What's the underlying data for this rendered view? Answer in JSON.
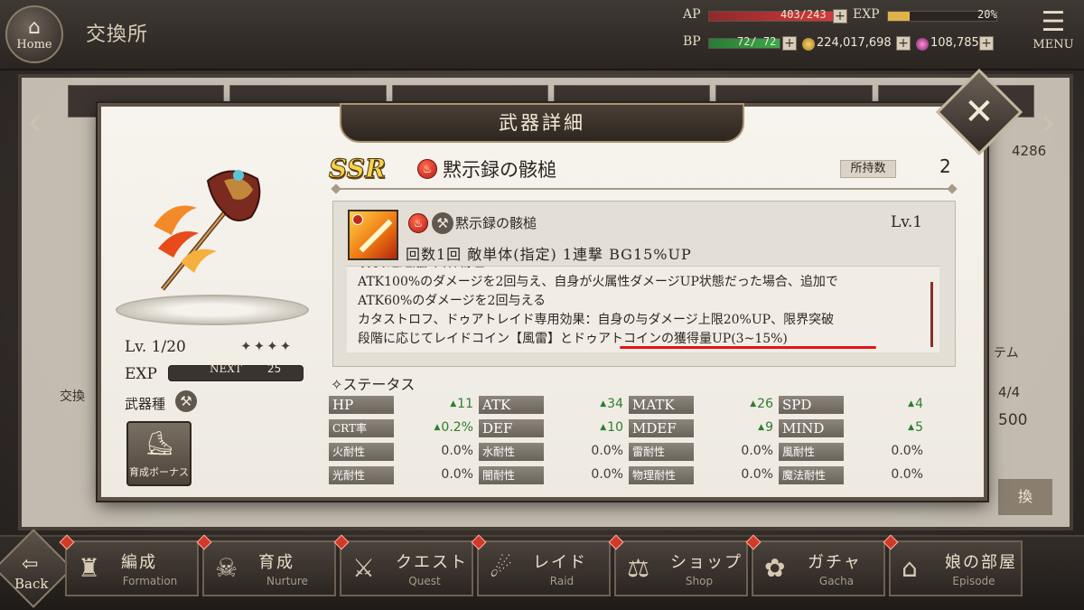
{
  "header": {
    "home_label": "Home",
    "title": "交換所",
    "ap_label": "AP",
    "ap_value": "403/243",
    "exp_label": "EXP",
    "exp_value": "20%",
    "bp_label": "BP",
    "bp_value": "72/ 72",
    "gold": "224,017,698",
    "gems": "108,785",
    "menu_label": "MENU",
    "colors": {
      "ap": "#d23a3a",
      "exp": "#e0b24a",
      "bp": "#3aa84a"
    }
  },
  "background": {
    "number": "4286",
    "text_a": "テム",
    "text_b": "4/4",
    "text_c": "500",
    "text_d": "交換",
    "button": "換"
  },
  "modal": {
    "title": "武器詳細",
    "rarity": "SSR",
    "weapon_name": "黙示録の骸槌",
    "owned_label": "所持数",
    "owned_count": "2",
    "level": "Lv.  1/20",
    "stars": "✦✦✦✦",
    "exp_label": "EXP",
    "exp_next_label": "NEXT",
    "exp_next_value": "25",
    "weapon_type_label": "武器種",
    "bonus_button": "育成ボーナス",
    "skill": {
      "name": "黙示録の骸槌",
      "level": "Lv.1",
      "summary": "回数1回  敵単体(指定)  1連撃  BG15%UP",
      "desc_lines": [
        "攻撃/近距離/単体/物理",
        "ATK100%のダメージを2回与え、自身が火属性ダメージUP状態だった場合、追加で",
        "ATK60%のダメージを2回与える",
        "カタストロフ、ドゥアトレイド専用効果：自身の与ダメージ上限20%UP、限界突破",
        "段階に応じてレイドコイン【風雷】とドゥアトコインの獲得量UP(3~15%)"
      ]
    },
    "status_header": "ステータス",
    "stats": [
      [
        {
          "label": "HP",
          "value": "11",
          "up": true
        },
        {
          "label": "ATK",
          "value": "34",
          "up": true
        },
        {
          "label": "MATK",
          "value": "26",
          "up": true
        },
        {
          "label": "SPD",
          "value": "4",
          "up": true
        }
      ],
      [
        {
          "label": "CRT率",
          "value": "0.2%",
          "up": true
        },
        {
          "label": "DEF",
          "value": "10",
          "up": true
        },
        {
          "label": "MDEF",
          "value": "9",
          "up": true
        },
        {
          "label": "MIND",
          "value": "5",
          "up": true
        }
      ],
      [
        {
          "label": "火耐性",
          "value": "0.0%",
          "up": false
        },
        {
          "label": "水耐性",
          "value": "0.0%",
          "up": false
        },
        {
          "label": "雷耐性",
          "value": "0.0%",
          "up": false
        },
        {
          "label": "風耐性",
          "value": "0.0%",
          "up": false
        }
      ],
      [
        {
          "label": "光耐性",
          "value": "0.0%",
          "up": false
        },
        {
          "label": "闇耐性",
          "value": "0.0%",
          "up": false
        },
        {
          "label": "物理耐性",
          "value": "0.0%",
          "up": false
        },
        {
          "label": "魔法耐性",
          "value": "0.0%",
          "up": false
        }
      ]
    ],
    "accent_underline_color": "#e0151b"
  },
  "nav": {
    "back_label": "Back",
    "items": [
      {
        "jp": "編成",
        "en": "Formation",
        "icon": "formation-icon"
      },
      {
        "jp": "育成",
        "en": "Nurture",
        "icon": "nurture-icon"
      },
      {
        "jp": "クエスト",
        "en": "Quest",
        "icon": "quest-icon"
      },
      {
        "jp": "レイド",
        "en": "Raid",
        "icon": "raid-icon"
      },
      {
        "jp": "ショップ",
        "en": "Shop",
        "icon": "shop-icon"
      },
      {
        "jp": "ガチャ",
        "en": "Gacha",
        "icon": "gacha-icon"
      },
      {
        "jp": "娘の部屋",
        "en": "Episode",
        "icon": "episode-icon"
      }
    ]
  }
}
